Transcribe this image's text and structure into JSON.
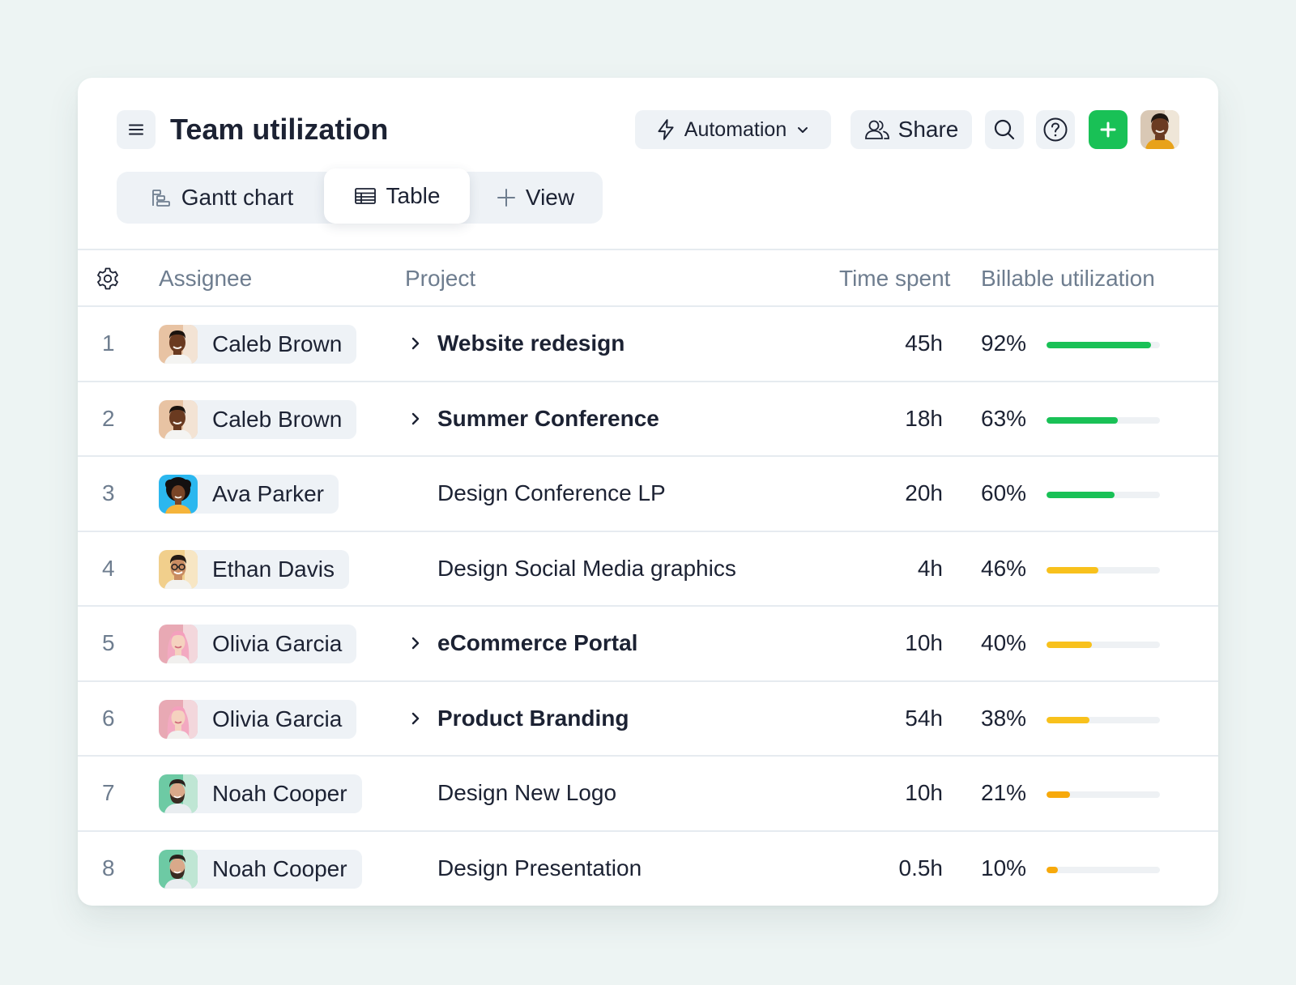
{
  "header": {
    "title": "Team utilization",
    "automation_label": "Automation",
    "share_label": "Share"
  },
  "tabs": [
    {
      "label": "Gantt chart",
      "icon": "gantt-icon"
    },
    {
      "label": "Table",
      "icon": "table-icon",
      "active": true
    },
    {
      "label": "View",
      "icon": "plus-icon"
    }
  ],
  "columns": {
    "assignee": "Assignee",
    "project": "Project",
    "time_spent": "Time spent",
    "billable": "Billable utilization"
  },
  "colors": {
    "accent_green": "#19c156",
    "bar_green": "#19c156",
    "bar_yellow": "#f8c11c",
    "bar_orange": "#f7a90b"
  },
  "rows": [
    {
      "num": "1",
      "assignee": "Caleb Brown",
      "avatar": "caleb",
      "project": "Website redesign",
      "expandable": true,
      "time": "45h",
      "pct_label": "92%",
      "pct": 92,
      "color": "#19c156"
    },
    {
      "num": "2",
      "assignee": "Caleb Brown",
      "avatar": "caleb",
      "project": "Summer Conference",
      "expandable": true,
      "time": "18h",
      "pct_label": "63%",
      "pct": 63,
      "color": "#19c156"
    },
    {
      "num": "3",
      "assignee": "Ava Parker",
      "avatar": "ava",
      "project": "Design Conference LP",
      "expandable": false,
      "time": "20h",
      "pct_label": "60%",
      "pct": 60,
      "color": "#19c156"
    },
    {
      "num": "4",
      "assignee": "Ethan Davis",
      "avatar": "ethan",
      "project": "Design Social Media graphics",
      "expandable": false,
      "time": "4h",
      "pct_label": "46%",
      "pct": 46,
      "color": "#f8c11c"
    },
    {
      "num": "5",
      "assignee": "Olivia Garcia",
      "avatar": "olivia",
      "project": "eCommerce Portal",
      "expandable": true,
      "time": "10h",
      "pct_label": "40%",
      "pct": 40,
      "color": "#f8c11c"
    },
    {
      "num": "6",
      "assignee": "Olivia Garcia",
      "avatar": "olivia",
      "project": "Product Branding",
      "expandable": true,
      "time": "54h",
      "pct_label": "38%",
      "pct": 38,
      "color": "#f8c11c"
    },
    {
      "num": "7",
      "assignee": "Noah Cooper",
      "avatar": "noah",
      "project": "Design New Logo",
      "expandable": false,
      "time": "10h",
      "pct_label": "21%",
      "pct": 21,
      "color": "#f7a90b"
    },
    {
      "num": "8",
      "assignee": "Noah Cooper",
      "avatar": "noah",
      "project": "Design Presentation",
      "expandable": false,
      "time": "0.5h",
      "pct_label": "10%",
      "pct": 10,
      "color": "#f7a90b"
    }
  ]
}
